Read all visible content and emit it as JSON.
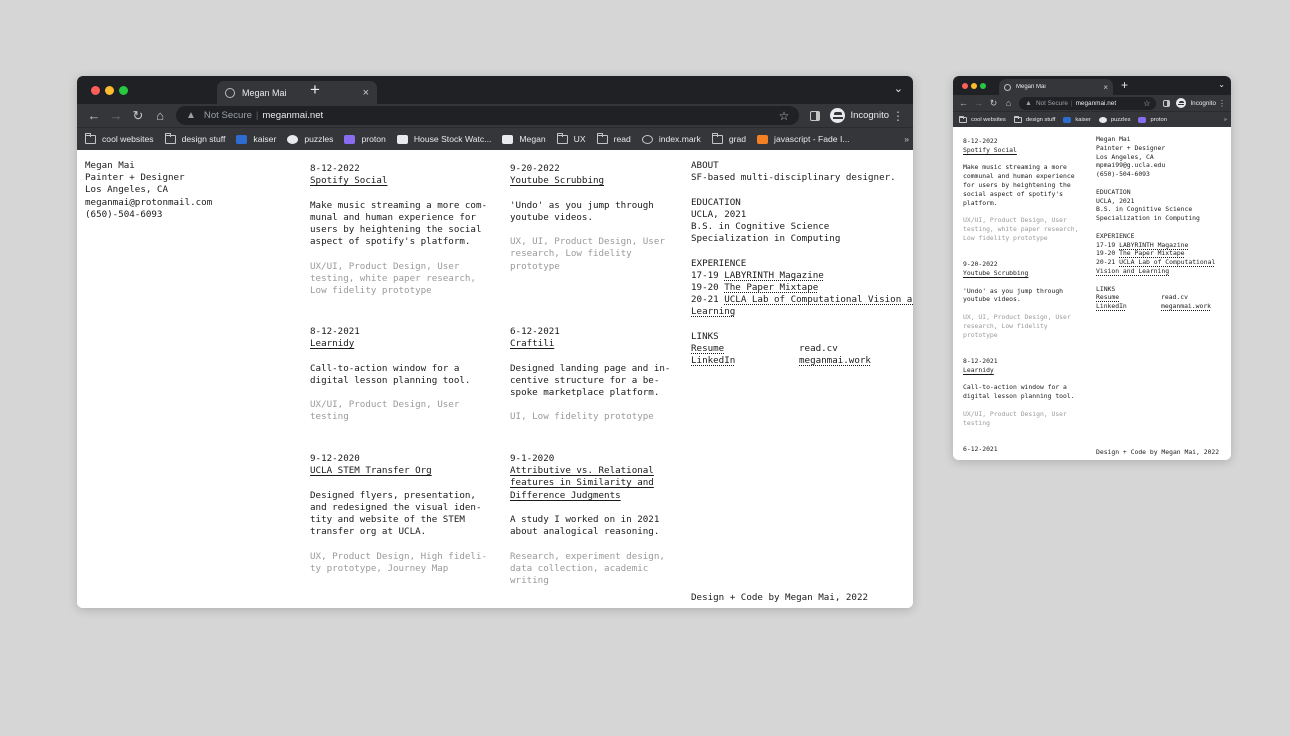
{
  "browser": {
    "tab_title": "Megan Mai",
    "tab_close": "×",
    "new_tab": "+",
    "tab_menu": "⌄",
    "back": "←",
    "forward": "→",
    "reload": "↻",
    "home": "⌂",
    "warning_icon": "▲",
    "not_secure": "Not Secure",
    "separator": "|",
    "url": "meganmai.net",
    "star": "☆",
    "profile": "Incognito",
    "menu": "⋮",
    "more_bookmarks": "»",
    "bookmarks": [
      {
        "label": "cool websites",
        "icon": "folder-icon"
      },
      {
        "label": "design stuff",
        "icon": "folder-icon"
      },
      {
        "label": "kaiser",
        "icon": "kaiser-favicon",
        "color": "#2f6cd1"
      },
      {
        "label": "puzzles",
        "icon": "puzzles-favicon",
        "color": "#e8eaed"
      },
      {
        "label": "proton",
        "icon": "proton-favicon",
        "color": "#8a6cf0"
      },
      {
        "label": "House Stock Watc...",
        "icon": "house-stock-favicon",
        "color": "#e8eaed"
      },
      {
        "label": "Megan",
        "icon": "megan-favicon",
        "color": "#e8eaed"
      },
      {
        "label": "UX",
        "icon": "folder-icon"
      },
      {
        "label": "read",
        "icon": "folder-icon"
      },
      {
        "label": "index.mark",
        "icon": "globe-icon"
      },
      {
        "label": "grad",
        "icon": "folder-icon"
      },
      {
        "label": "javascript - Fade I...",
        "icon": "stackoverflow-favicon",
        "color": "#f48024"
      }
    ]
  },
  "small_browser": {
    "bookmarks": [
      {
        "label": "cool websites",
        "icon": "folder-icon"
      },
      {
        "label": "design stuff",
        "icon": "folder-icon"
      },
      {
        "label": "kaiser",
        "icon": "kaiser-favicon",
        "color": "#2f6cd1"
      },
      {
        "label": "puzzles",
        "icon": "puzzles-favicon",
        "color": "#e8eaed"
      },
      {
        "label": "proton",
        "icon": "proton-favicon",
        "color": "#8a6cf0"
      }
    ]
  },
  "site": {
    "name": "Megan Mai",
    "role": "Painter + Designer",
    "location": "Los Angeles, CA",
    "email": "meganmai@protonmail.com",
    "phone": "(650)-504-6093",
    "small_email": "mpmai99@g.ucla.edu",
    "projects": [
      {
        "date": "8-12-2022",
        "title": "Spotify Social",
        "desc": [
          "Make music streaming a more com-",
          "munal and human experience for",
          "users by heightening the social",
          "aspect of spotify's platform."
        ],
        "tags": [
          "UX/UI, Product Design, User",
          "testing, white paper research,",
          "Low fidelity prototype"
        ]
      },
      {
        "date": "9-20-2022",
        "title": "Youtube Scrubbing",
        "desc": [
          "'Undo' as you jump through",
          "youtube videos."
        ],
        "tags": [
          "UX, UI, Product Design, User",
          "research, Low fidelity",
          "prototype"
        ]
      },
      {
        "date": "8-12-2021",
        "title": "Learnidy",
        "desc": [
          "Call-to-action window for a",
          "digital lesson planning tool."
        ],
        "tags": [
          "UX/UI, Product Design, User",
          "testing"
        ]
      },
      {
        "date": "6-12-2021",
        "title": "Craftili",
        "desc": [
          "Designed landing page and in-",
          "centive structure for a be-",
          "spoke marketplace platform."
        ],
        "tags": [
          "UI, Low fidelity prototype"
        ]
      },
      {
        "date": "9-12-2020",
        "title": "UCLA STEM Transfer Org",
        "desc": [
          "Designed flyers, presentation,",
          "and redesigned the visual iden-",
          "tity and website of the STEM",
          "transfer org at UCLA."
        ],
        "tags": [
          "UX, Product Design, High fideli-",
          "ty prototype, Journey Map"
        ]
      },
      {
        "date": "9-1-2020",
        "title": [
          "Attributive vs. Relational",
          "features in Similarity and",
          "Difference Judgments"
        ],
        "desc": [
          "A study I worked on in 2021",
          "about analogical reasoning."
        ],
        "tags": [
          "Research, experiment design,",
          "data collection, academic",
          "writing"
        ]
      }
    ],
    "small_projects": [
      {
        "date": "8-12-2022",
        "title": "Spotify Social",
        "desc": [
          "Make music streaming a more",
          "communal and human experience",
          "for users by heightening the",
          "social aspect of spotify's",
          "platform."
        ],
        "tags": [
          "UX/UI, Product Design, User",
          "testing, white paper research,",
          "Low fidelity prototype"
        ]
      },
      {
        "date": "9-20-2022",
        "title": "Youtube Scrubbing",
        "desc": [
          "'Undo' as you jump through",
          "youtube videos."
        ],
        "tags": [
          "UX, UI, Product Design, User",
          "research, Low fidelity",
          "prototype"
        ]
      },
      {
        "date": "8-12-2021",
        "title": "Learnidy",
        "desc": [
          "Call-to-action window for a",
          "digital lesson planning tool."
        ],
        "tags": [
          "UX/UI, Product Design, User",
          "testing"
        ]
      },
      {
        "date": "6-12-2021"
      }
    ],
    "about": {
      "heading": "ABOUT",
      "text": "SF-based multi-disciplinary designer."
    },
    "education": {
      "heading": "EDUCATION",
      "lines": [
        "UCLA, 2021",
        "B.S. in Cognitive Science",
        "Specialization in Computing"
      ]
    },
    "experience": {
      "heading": "EXPERIENCE",
      "items": [
        {
          "years": "17-19",
          "name": "LABYRINTH Magazine"
        },
        {
          "years": "19-20",
          "name": "The Paper Mixtape"
        },
        {
          "years": "20-21",
          "name": "UCLA Lab of Computational Vision and",
          "name2": "Learning"
        }
      ],
      "small_items": [
        {
          "years": "17-19",
          "name": "LABYRINTH Magazine"
        },
        {
          "years": "19-20",
          "name": "The Paper Mixtape"
        },
        {
          "years": "20-21",
          "name": "UCLA Lab of Computational",
          "name2": "Vision and Learning"
        }
      ]
    },
    "links": {
      "heading": "LINKS",
      "items": [
        {
          "label": "Resume"
        },
        {
          "label": "read.cv"
        },
        {
          "label": "LinkedIn"
        },
        {
          "label": "meganmai.work"
        }
      ]
    },
    "footer": "Design + Code by Megan Mai, 2022"
  }
}
